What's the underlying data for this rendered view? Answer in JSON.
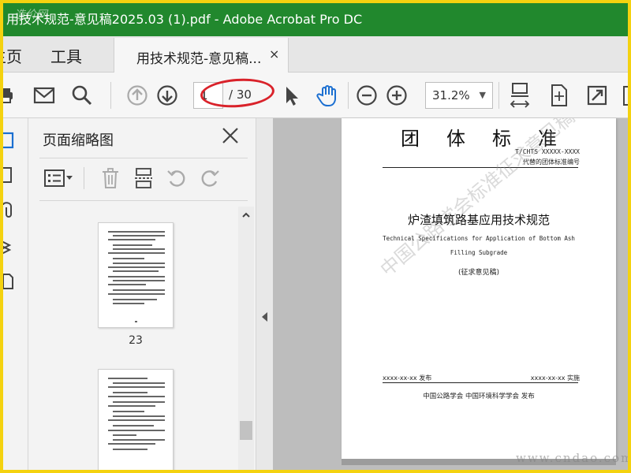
{
  "window": {
    "title": "用技术规范-意见稿2025.03 (1).pdf - Adobe Acrobat Pro DC",
    "watermark_text": "造价网"
  },
  "menu": {
    "home": "主页",
    "tools": "工具"
  },
  "tab": {
    "label": "用技术规范-意见稿...",
    "close": "×"
  },
  "toolbar": {
    "current_page": "1",
    "total_pages": "/ 30",
    "zoom": "31.2%"
  },
  "panel": {
    "title": "页面缩略图",
    "thumbnails": [
      {
        "label": "23"
      },
      {
        "label": ""
      }
    ]
  },
  "document": {
    "heading": "团体标准",
    "code": "T/CHTS XXXXX-XXXX",
    "replaces": "代替的团体标准编号",
    "name_cn": "炉渣填筑路基应用技术规范",
    "name_en_line1": "Technical Specifications for Application of Bottom Ash",
    "name_en_line2": "Filling Subgrade",
    "stage": "(征求意见稿)",
    "release": "xxxx-xx-xx 发布",
    "implement": "xxxx-xx-xx 实施",
    "publisher": "中国公路学会  中国环境科学学会  发布",
    "watermark": "中国公路学会标准征求意见稿"
  },
  "site_watermark": "www.cndao.com",
  "colors": {
    "titlebar": "#21882d",
    "annotation_oval": "#d9222a",
    "frame_border": "#f4d20f",
    "hand_tool_active": "#1b6fd1"
  }
}
